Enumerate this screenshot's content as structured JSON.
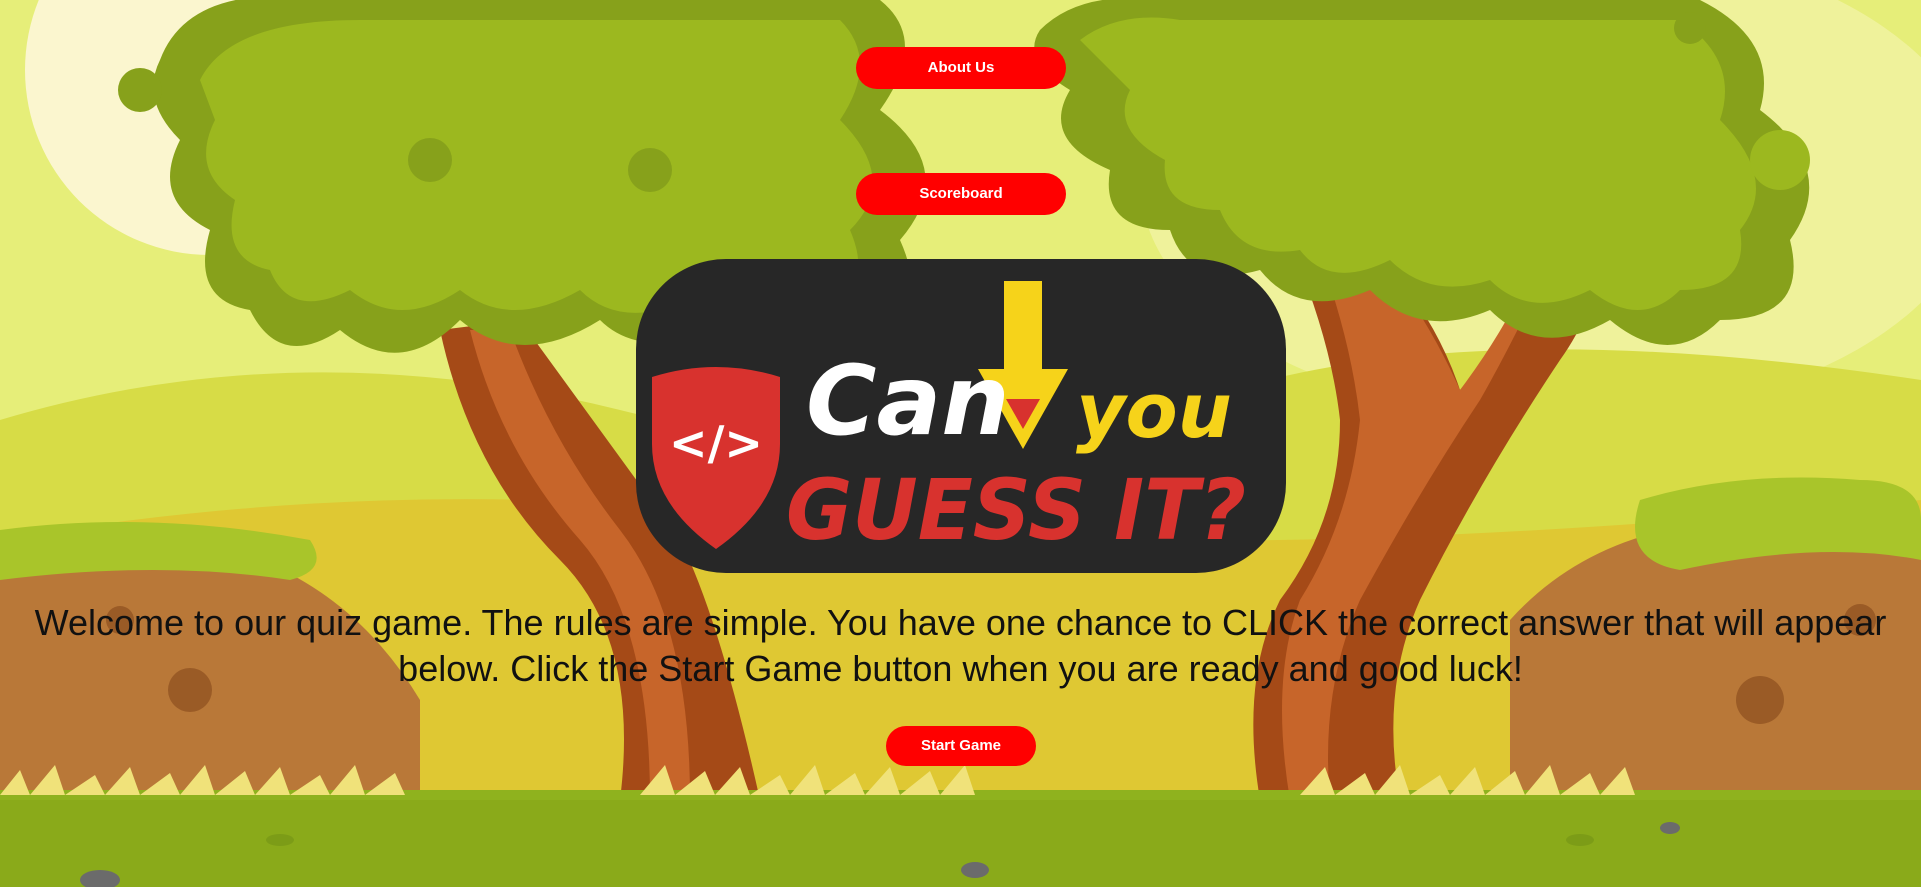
{
  "nav": {
    "about_label": "About Us",
    "scoreboard_label": "Scoreboard"
  },
  "logo": {
    "line1_word1": "Can",
    "line1_word2": "you",
    "line2": "GUESS IT?",
    "badge_glyph": "</>"
  },
  "intro": {
    "rules_text": "Welcome to our quiz game. The rules are simple. You have one chance to CLICK the correct answer that will appear below. Click the Start Game button when you are ready and good luck!"
  },
  "actions": {
    "start_label": "Start Game"
  },
  "colors": {
    "button": "#ff0000",
    "logo_bg": "#272727",
    "logo_red": "#d8322e",
    "logo_yellow": "#f6d31a"
  }
}
